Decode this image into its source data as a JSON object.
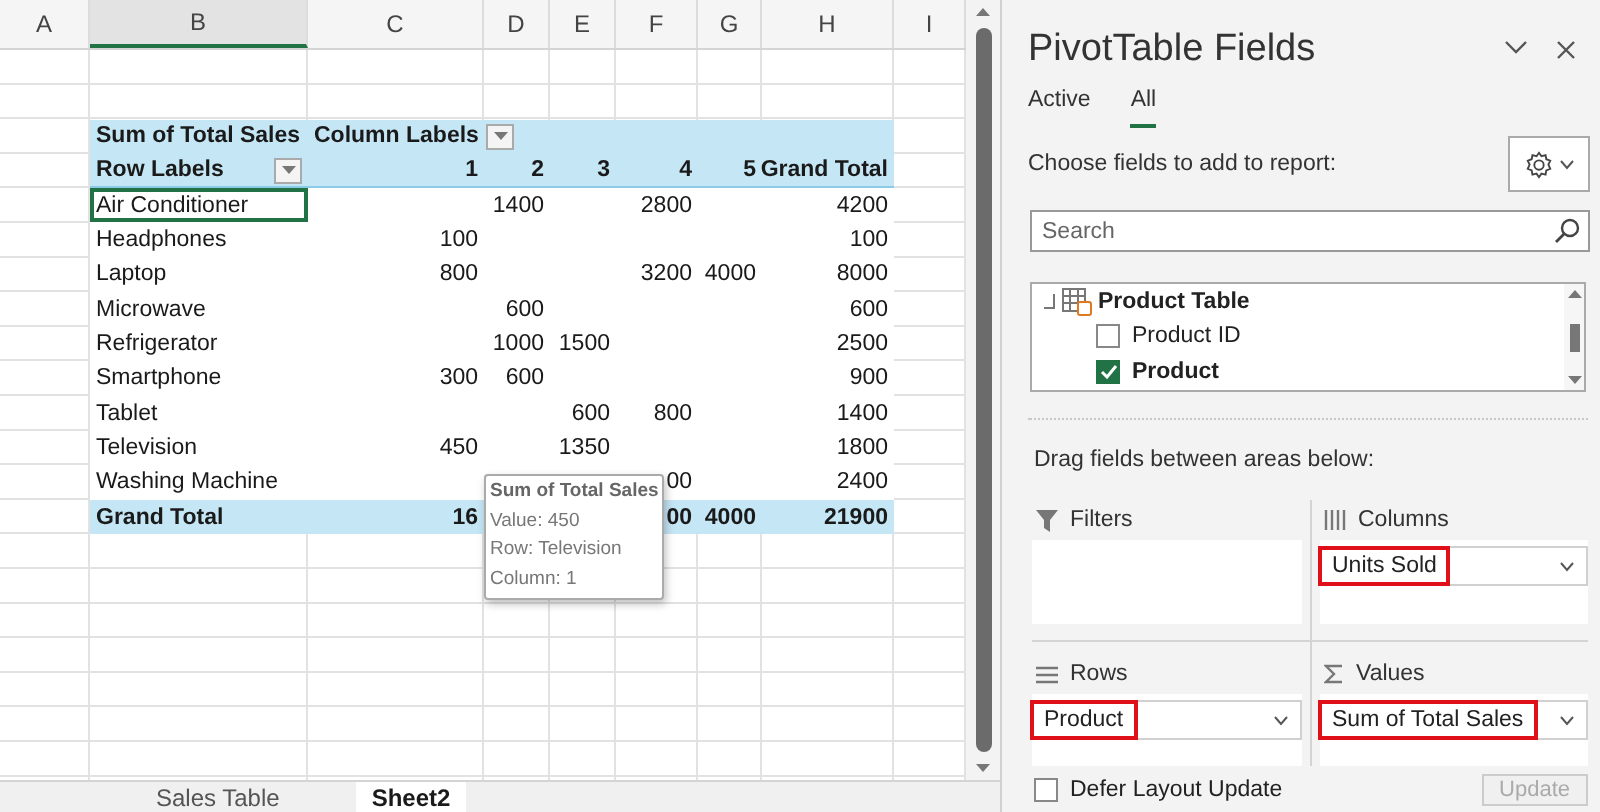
{
  "sheet": {
    "columns": [
      {
        "label": "A",
        "selected": false
      },
      {
        "label": "B",
        "selected": true
      },
      {
        "label": "C",
        "selected": false
      },
      {
        "label": "D",
        "selected": false
      },
      {
        "label": "E",
        "selected": false
      },
      {
        "label": "F",
        "selected": false
      },
      {
        "label": "G",
        "selected": false
      },
      {
        "label": "H",
        "selected": false
      },
      {
        "label": "I",
        "selected": false
      }
    ],
    "pivot": {
      "value_label": "Sum of Total Sales",
      "column_labels": "Column Labels",
      "row_labels": "Row Labels",
      "column_keys": [
        "1",
        "2",
        "3",
        "4",
        "5",
        "Grand Total"
      ],
      "rows": [
        {
          "label": "Air Conditioner",
          "kind": "item",
          "selected": true,
          "values": {
            "c2": "1400",
            "c4": "2800",
            "c6": "4200"
          }
        },
        {
          "label": "Headphones",
          "kind": "item",
          "selected": false,
          "values": {
            "c1": "100",
            "c6": "100"
          }
        },
        {
          "label": "Laptop",
          "kind": "item",
          "selected": false,
          "values": {
            "c1": "800",
            "c4": "3200",
            "c5": "4000",
            "c6": "8000"
          }
        },
        {
          "label": "Microwave",
          "kind": "item",
          "selected": false,
          "values": {
            "c2": "600",
            "c6": "600"
          }
        },
        {
          "label": "Refrigerator",
          "kind": "item",
          "selected": false,
          "values": {
            "c2": "1000",
            "c3": "1500",
            "c6": "2500"
          }
        },
        {
          "label": "Smartphone",
          "kind": "item",
          "selected": false,
          "values": {
            "c1": "300",
            "c2": "600",
            "c6": "900"
          }
        },
        {
          "label": "Tablet",
          "kind": "item",
          "selected": false,
          "values": {
            "c3": "600",
            "c4": "800",
            "c6": "1400"
          }
        },
        {
          "label": "Television",
          "kind": "item",
          "selected": false,
          "values": {
            "c1": "450",
            "c3": "1350",
            "c6": "1800"
          }
        },
        {
          "label": "Washing Machine",
          "kind": "item",
          "selected": false,
          "values": {
            "c4": "00",
            "c6": "2400"
          }
        },
        {
          "label": "Grand Total",
          "kind": "total",
          "selected": false,
          "values": {
            "c1": "16",
            "c4": "00",
            "c5": "4000",
            "c6": "21900"
          }
        }
      ]
    },
    "tooltip": {
      "title": "Sum of Total Sales",
      "lines": [
        "Value: 450",
        "Row: Television",
        "Column: 1"
      ]
    },
    "sheet_tabs": [
      {
        "label": "Sales Table",
        "selected": false
      },
      {
        "label": "Sheet2",
        "selected": true
      }
    ]
  },
  "panel": {
    "title": "PivotTable Fields",
    "tabs": [
      {
        "label": "Active",
        "selected": false
      },
      {
        "label": "All",
        "selected": true
      }
    ],
    "choose_label": "Choose fields to add to report:",
    "search": {
      "placeholder": "Search"
    },
    "field_table": "Product Table",
    "fields": [
      {
        "label": "Product ID",
        "checked": false
      },
      {
        "label": "Product",
        "checked": true
      }
    ],
    "drag_label": "Drag fields between areas below:",
    "areas": [
      {
        "kind": "filters",
        "label": "Filters"
      },
      {
        "kind": "columns",
        "label": "Columns",
        "items": [
          {
            "label": "Units Sold",
            "highlighted": true
          }
        ]
      },
      {
        "kind": "rows",
        "label": "Rows",
        "items": [
          {
            "label": "Product",
            "highlighted": true
          }
        ]
      },
      {
        "kind": "values",
        "label": "Values",
        "items": [
          {
            "label": "Sum of Total Sales",
            "highlighted": true
          }
        ]
      }
    ],
    "defer": {
      "label": "Defer Layout Update",
      "checked": false
    },
    "update_button": {
      "label": "Update",
      "disabled": true
    }
  }
}
